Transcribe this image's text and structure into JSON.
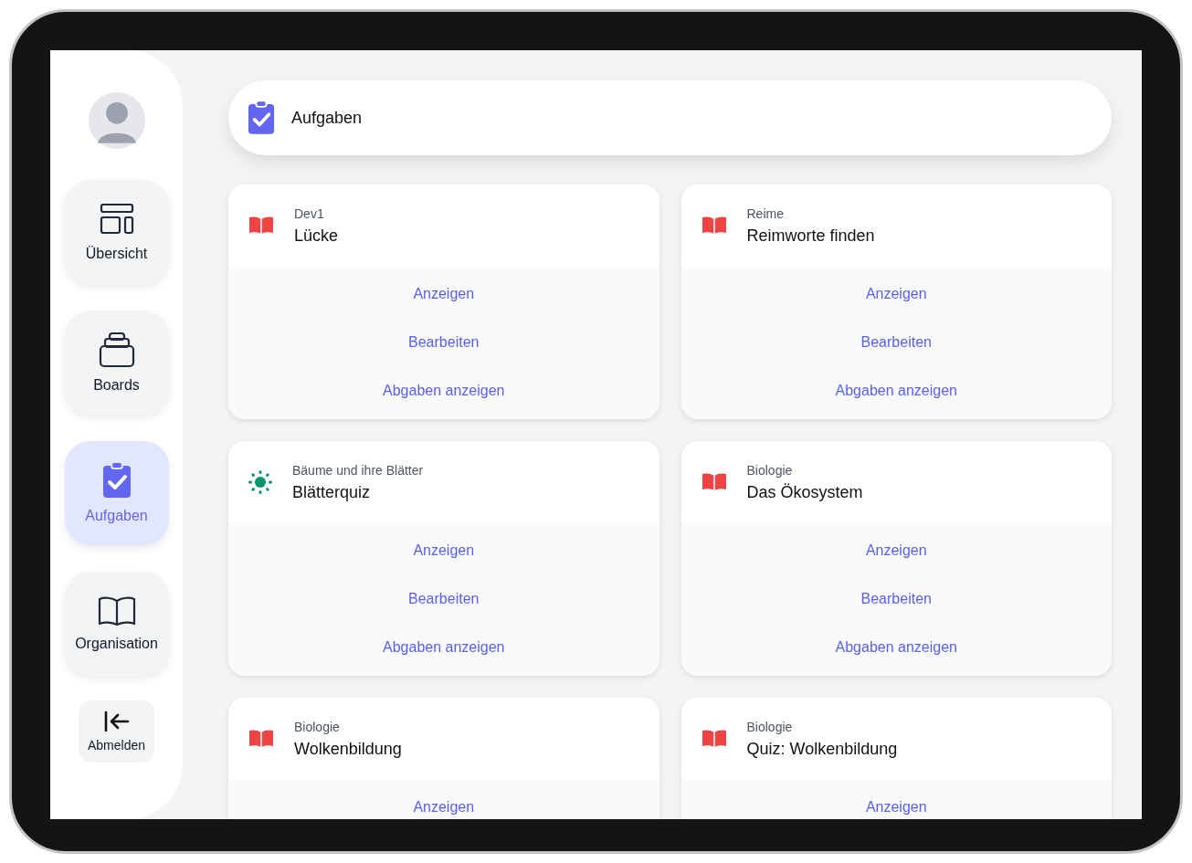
{
  "sidebar": {
    "items": [
      {
        "label": "Übersicht",
        "kind": "layout",
        "selected": false
      },
      {
        "label": "Boards",
        "kind": "stack",
        "selected": false
      },
      {
        "label": "Aufgaben",
        "kind": "clipboard",
        "selected": true
      },
      {
        "label": "Organisation",
        "kind": "book",
        "selected": false
      }
    ],
    "logout": {
      "label": "Abmelden"
    }
  },
  "header": {
    "title": "Aufgaben"
  },
  "cards": [
    {
      "kind": "book",
      "category": "Dev1",
      "title": "Lücke",
      "actions": [
        "Anzeigen",
        "Bearbeiten",
        "Abgaben anzeigen"
      ]
    },
    {
      "kind": "book",
      "category": "Reime",
      "title": "Reimworte finden",
      "actions": [
        "Anzeigen",
        "Bearbeiten",
        "Abgaben anzeigen"
      ]
    },
    {
      "kind": "sun",
      "category": "Bäume und ihre Blätter",
      "title": "Blätterquiz",
      "actions": [
        "Anzeigen",
        "Bearbeiten",
        "Abgaben anzeigen"
      ]
    },
    {
      "kind": "book",
      "category": "Biologie",
      "title": "Das Ökosystem",
      "actions": [
        "Anzeigen",
        "Bearbeiten",
        "Abgaben anzeigen"
      ]
    },
    {
      "kind": "book",
      "category": "Biologie",
      "title": "Wolkenbildung",
      "actions": [
        "Anzeigen"
      ]
    },
    {
      "kind": "book",
      "category": "Biologie",
      "title": "Quiz: Wolkenbildung",
      "actions": [
        "Anzeigen"
      ]
    }
  ]
}
